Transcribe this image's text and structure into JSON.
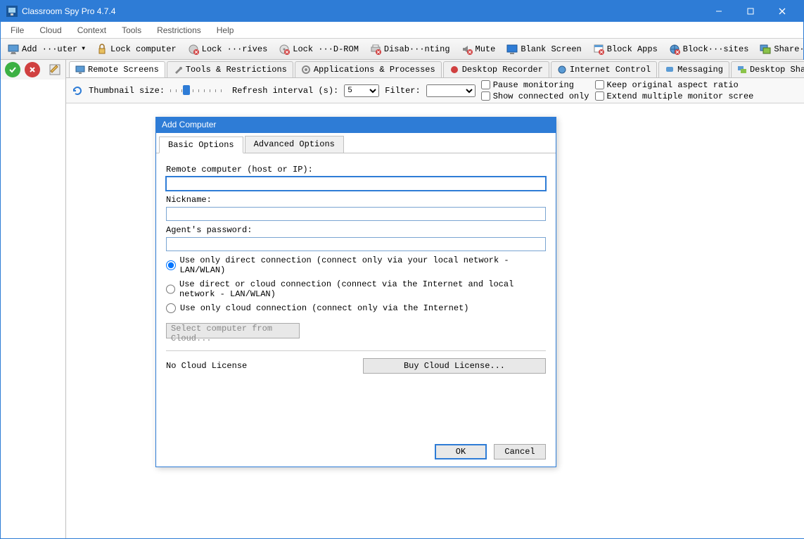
{
  "window": {
    "title": "Classroom Spy Pro 4.7.4"
  },
  "menu": {
    "file": "File",
    "cloud": "Cloud",
    "context": "Context",
    "tools": "Tools",
    "restrictions": "Restrictions",
    "help": "Help"
  },
  "toolbar": {
    "add_computer": "Add ···uter",
    "lock_computer": "Lock computer",
    "lock_drives": "Lock ···rives",
    "lock_cdrom": "Lock ···D-ROM",
    "disab_nting": "Disab···nting",
    "mute": "Mute",
    "blank_screen": "Blank Screen",
    "block_apps": "Block Apps",
    "block_sites": "Block···sites",
    "share_desktop": "Share···sktop"
  },
  "tabs": {
    "remote_screens": "Remote Screens",
    "tools_restrictions": "Tools & Restrictions",
    "apps_processes": "Applications & Processes",
    "desktop_recorder": "Desktop Recorder",
    "internet_control": "Internet Control",
    "messaging": "Messaging",
    "desktop_shari": "Desktop Shari"
  },
  "options": {
    "thumbnail_label": "Thumbnail size:",
    "refresh_label": "Refresh interval (s):",
    "refresh_value": "5",
    "filter_label": "Filter:",
    "filter_value": "",
    "pause_monitoring": "Pause monitoring",
    "show_connected": "Show connected only",
    "keep_ratio": "Keep original aspect ratio",
    "extend_monitor": "Extend multiple monitor scree"
  },
  "dialog": {
    "title": "Add Computer",
    "tab_basic": "Basic Options",
    "tab_advanced": "Advanced Options",
    "host_label": "Remote computer (host or IP):",
    "host_value": "",
    "nickname_label": "Nickname:",
    "nickname_value": "",
    "password_label": "Agent's password:",
    "password_value": "",
    "radio_direct": "Use only direct connection (connect only via your local network - LAN/WLAN)",
    "radio_both": "Use direct or cloud connection (connect via the Internet and local network - LAN/WLAN)",
    "radio_cloud": "Use only cloud connection (connect only via the Internet)",
    "select_cloud": "Select computer from Cloud...",
    "no_license": "No Cloud License",
    "buy_license": "Buy Cloud License...",
    "ok": "OK",
    "cancel": "Cancel"
  }
}
